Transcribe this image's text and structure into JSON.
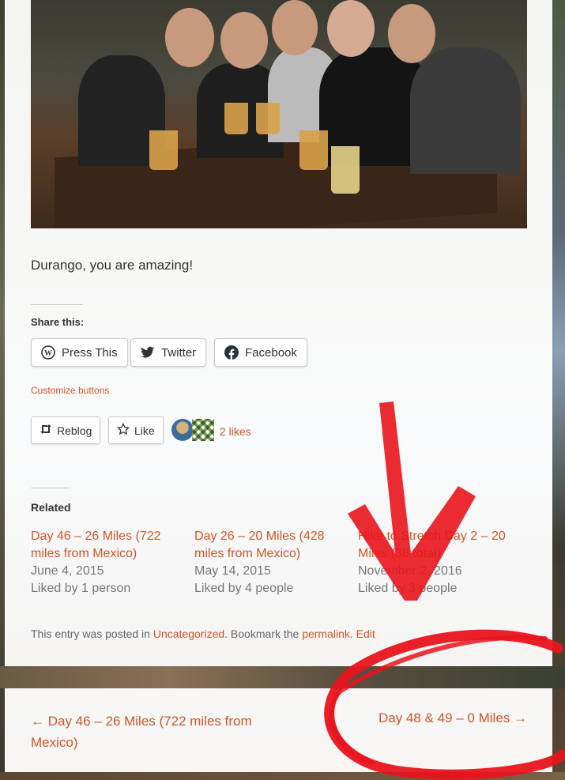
{
  "post": {
    "caption": "Durango, you are amazing!",
    "photo_icon": "group-photo"
  },
  "share": {
    "title": "Share this:",
    "buttons": [
      {
        "label": "Press This",
        "icon": "wordpress-icon"
      },
      {
        "label": "Twitter",
        "icon": "twitter-icon"
      },
      {
        "label": "Facebook",
        "icon": "facebook-icon"
      }
    ],
    "customize_label": "Customize buttons"
  },
  "likes": {
    "reblog_label": "Reblog",
    "like_label": "Like",
    "count_label": "2 likes"
  },
  "related": {
    "title": "Related",
    "items": [
      {
        "title": "Day 46 – 26 Miles (722 miles from Mexico)",
        "date": "June 4, 2015",
        "liked": "Liked by 1 person"
      },
      {
        "title": "Day 26 – 20 Miles (428 miles from Mexico)",
        "date": "May 14, 2015",
        "liked": "Liked by 4 people"
      },
      {
        "title": "Hike to Stretch Day 2 – 20 Miles (38 total)",
        "date": "November 2, 2016",
        "liked": "Liked by 3 people"
      }
    ]
  },
  "entry_meta": {
    "prefix": "This entry was posted in ",
    "category": "Uncategorized",
    "middle": ". Bookmark the ",
    "permalink": "permalink",
    "dot": ".",
    "edit": "Edit"
  },
  "post_nav": {
    "prev": "← Day 46 – 26 Miles (722 miles from Mexico)",
    "next": "Day 48 & 49 – 0 Miles →"
  },
  "colors": {
    "accent": "#d35427",
    "annotation": "#e8141c"
  }
}
